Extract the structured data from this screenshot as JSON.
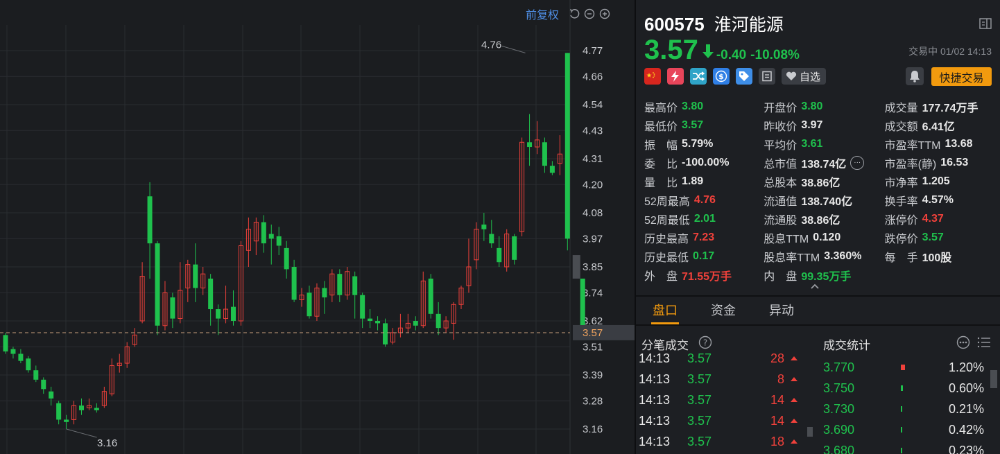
{
  "chart": {
    "fq_label": "前复权",
    "high_label": "4.76",
    "low_label": "3.16",
    "current_label": "3.57",
    "colors": {
      "up": "#f0413b",
      "down": "#1fc14d",
      "grid": "#2a2d31",
      "dash": "#c99f7d",
      "axis_text": "#c9cbcf"
    }
  },
  "chart_data": {
    "type": "candlestick",
    "ylim": [
      3.1,
      4.82
    ],
    "yticks": [
      "4.77",
      "4.66",
      "4.54",
      "4.43",
      "4.31",
      "4.20",
      "4.08",
      "3.97",
      "3.85",
      "3.74",
      "3.62",
      "3.51",
      "3.39",
      "3.28",
      "3.16"
    ],
    "last_price": 3.57,
    "candles": [
      {
        "o": 3.56,
        "c": 3.49,
        "h": 3.57,
        "l": 3.48
      },
      {
        "o": 3.5,
        "c": 3.48,
        "h": 3.51,
        "l": 3.46
      },
      {
        "o": 3.48,
        "c": 3.45,
        "h": 3.5,
        "l": 3.44
      },
      {
        "o": 3.46,
        "c": 3.41,
        "h": 3.47,
        "l": 3.4
      },
      {
        "o": 3.41,
        "c": 3.37,
        "h": 3.43,
        "l": 3.36
      },
      {
        "o": 3.37,
        "c": 3.33,
        "h": 3.38,
        "l": 3.31
      },
      {
        "o": 3.32,
        "c": 3.29,
        "h": 3.34,
        "l": 3.26
      },
      {
        "o": 3.27,
        "c": 3.2,
        "h": 3.28,
        "l": 3.18
      },
      {
        "o": 3.2,
        "c": 3.19,
        "h": 3.22,
        "l": 3.16
      },
      {
        "o": 3.2,
        "c": 3.26,
        "h": 3.28,
        "l": 3.18
      },
      {
        "o": 3.26,
        "c": 3.24,
        "h": 3.29,
        "l": 3.22
      },
      {
        "o": 3.25,
        "c": 3.26,
        "h": 3.29,
        "l": 3.24
      },
      {
        "o": 3.25,
        "c": 3.24,
        "h": 3.27,
        "l": 3.23
      },
      {
        "o": 3.26,
        "c": 3.32,
        "h": 3.34,
        "l": 3.25
      },
      {
        "o": 3.31,
        "c": 3.43,
        "h": 3.46,
        "l": 3.3
      },
      {
        "o": 3.43,
        "c": 3.44,
        "h": 3.48,
        "l": 3.4
      },
      {
        "o": 3.44,
        "c": 3.51,
        "h": 3.53,
        "l": 3.42
      },
      {
        "o": 3.52,
        "c": 3.56,
        "h": 3.59,
        "l": 3.51
      },
      {
        "o": 3.62,
        "c": 3.81,
        "h": 3.87,
        "l": 3.61
      },
      {
        "o": 4.15,
        "c": 3.95,
        "h": 4.21,
        "l": 3.8
      },
      {
        "o": 3.95,
        "c": 3.6,
        "h": 3.96,
        "l": 3.56
      },
      {
        "o": 3.6,
        "c": 3.74,
        "h": 3.79,
        "l": 3.58
      },
      {
        "o": 3.72,
        "c": 3.63,
        "h": 3.74,
        "l": 3.59
      },
      {
        "o": 3.63,
        "c": 3.75,
        "h": 3.87,
        "l": 3.61
      },
      {
        "o": 3.76,
        "c": 3.86,
        "h": 3.88,
        "l": 3.7
      },
      {
        "o": 3.86,
        "c": 3.76,
        "h": 3.95,
        "l": 3.7
      },
      {
        "o": 3.76,
        "c": 3.82,
        "h": 3.85,
        "l": 3.73
      },
      {
        "o": 3.8,
        "c": 3.67,
        "h": 3.82,
        "l": 3.6
      },
      {
        "o": 3.67,
        "c": 3.63,
        "h": 3.69,
        "l": 3.56
      },
      {
        "o": 3.63,
        "c": 3.67,
        "h": 3.77,
        "l": 3.61
      },
      {
        "o": 3.68,
        "c": 3.62,
        "h": 3.75,
        "l": 3.6
      },
      {
        "o": 3.62,
        "c": 3.94,
        "h": 3.96,
        "l": 3.6
      },
      {
        "o": 3.92,
        "c": 4.01,
        "h": 4.06,
        "l": 3.85
      },
      {
        "o": 3.96,
        "c": 4.04,
        "h": 4.06,
        "l": 3.9
      },
      {
        "o": 4.04,
        "c": 3.95,
        "h": 4.07,
        "l": 3.91
      },
      {
        "o": 3.99,
        "c": 3.97,
        "h": 4.03,
        "l": 3.86
      },
      {
        "o": 3.98,
        "c": 3.94,
        "h": 4.02,
        "l": 3.9
      },
      {
        "o": 3.93,
        "c": 3.84,
        "h": 3.96,
        "l": 3.8
      },
      {
        "o": 3.85,
        "c": 3.71,
        "h": 3.88,
        "l": 3.7
      },
      {
        "o": 3.71,
        "c": 3.73,
        "h": 3.76,
        "l": 3.68
      },
      {
        "o": 3.74,
        "c": 3.64,
        "h": 3.77,
        "l": 3.63
      },
      {
        "o": 3.64,
        "c": 3.76,
        "h": 3.78,
        "l": 3.62
      },
      {
        "o": 3.76,
        "c": 3.72,
        "h": 3.79,
        "l": 3.65
      },
      {
        "o": 3.73,
        "c": 3.82,
        "h": 3.84,
        "l": 3.7
      },
      {
        "o": 3.82,
        "c": 3.73,
        "h": 3.84,
        "l": 3.7
      },
      {
        "o": 3.73,
        "c": 3.83,
        "h": 3.85,
        "l": 3.71
      },
      {
        "o": 3.81,
        "c": 3.73,
        "h": 3.83,
        "l": 3.63
      },
      {
        "o": 3.73,
        "c": 3.63,
        "h": 3.74,
        "l": 3.59
      },
      {
        "o": 3.63,
        "c": 3.62,
        "h": 3.67,
        "l": 3.59
      },
      {
        "o": 3.62,
        "c": 3.61,
        "h": 3.64,
        "l": 3.58
      },
      {
        "o": 3.61,
        "c": 3.52,
        "h": 3.63,
        "l": 3.51
      },
      {
        "o": 3.53,
        "c": 3.57,
        "h": 3.59,
        "l": 3.52
      },
      {
        "o": 3.57,
        "c": 3.59,
        "h": 3.65,
        "l": 3.55
      },
      {
        "o": 3.59,
        "c": 3.61,
        "h": 3.65,
        "l": 3.57
      },
      {
        "o": 3.62,
        "c": 3.6,
        "h": 3.64,
        "l": 3.58
      },
      {
        "o": 3.6,
        "c": 3.79,
        "h": 3.83,
        "l": 3.59
      },
      {
        "o": 3.8,
        "c": 3.65,
        "h": 3.82,
        "l": 3.63
      },
      {
        "o": 3.65,
        "c": 3.59,
        "h": 3.7,
        "l": 3.56
      },
      {
        "o": 3.59,
        "c": 3.62,
        "h": 3.64,
        "l": 3.57
      },
      {
        "o": 3.61,
        "c": 3.69,
        "h": 3.7,
        "l": 3.54
      },
      {
        "o": 3.69,
        "c": 3.76,
        "h": 3.77,
        "l": 3.67
      },
      {
        "o": 3.77,
        "c": 3.85,
        "h": 3.97,
        "l": 3.74
      },
      {
        "o": 3.88,
        "c": 4.01,
        "h": 4.04,
        "l": 3.84
      },
      {
        "o": 4.03,
        "c": 4.01,
        "h": 4.08,
        "l": 3.96
      },
      {
        "o": 3.99,
        "c": 3.95,
        "h": 4.05,
        "l": 3.93
      },
      {
        "o": 3.93,
        "c": 3.87,
        "h": 3.98,
        "l": 3.85
      },
      {
        "o": 3.85,
        "c": 3.99,
        "h": 4.01,
        "l": 3.83
      },
      {
        "o": 3.98,
        "c": 3.88,
        "h": 3.99,
        "l": 3.86
      },
      {
        "o": 4.0,
        "c": 4.38,
        "h": 4.4,
        "l": 3.98
      },
      {
        "o": 4.38,
        "c": 4.36,
        "h": 4.5,
        "l": 4.28
      },
      {
        "o": 4.36,
        "c": 4.39,
        "h": 4.47,
        "l": 4.33
      },
      {
        "o": 4.38,
        "c": 4.28,
        "h": 4.4,
        "l": 4.25
      },
      {
        "o": 4.28,
        "c": 4.25,
        "h": 4.3,
        "l": 4.24
      },
      {
        "o": 4.29,
        "c": 4.33,
        "h": 4.41,
        "l": 4.24
      },
      {
        "o": 4.76,
        "c": 3.97,
        "h": 4.76,
        "l": 3.92
      }
    ],
    "partial_bar": {
      "top": 3.9,
      "bottom": 3.8
    },
    "last_bar": {
      "o": 3.8,
      "c": 3.57
    }
  },
  "stock": {
    "code": "600575",
    "name": "淮河能源",
    "price": "3.57",
    "change": "-0.40",
    "change_pct": "-10.08%",
    "status": "交易中 01/02 14:13",
    "watch_label": "自选",
    "fast_trade_label": "快捷交易"
  },
  "stats": [
    [
      {
        "label": "最高价",
        "value": "3.80",
        "color": "green"
      },
      {
        "label": "开盘价",
        "value": "3.80",
        "color": "green"
      },
      {
        "label": "成交量",
        "value": "177.74万手",
        "color": "white"
      }
    ],
    [
      {
        "label": "最低价",
        "value": "3.57",
        "color": "green"
      },
      {
        "label": "昨收价",
        "value": "3.97",
        "color": "white"
      },
      {
        "label": "成交额",
        "value": "6.41亿",
        "color": "white"
      }
    ],
    [
      {
        "label": "振　幅",
        "value": "5.79%",
        "color": "white"
      },
      {
        "label": "平均价",
        "value": "3.61",
        "color": "green"
      },
      {
        "label": "市盈率TTM",
        "value": "13.68",
        "color": "white"
      }
    ],
    [
      {
        "label": "委　比",
        "value": "-100.00%",
        "color": "white"
      },
      {
        "label": "总市值",
        "value": "138.74亿",
        "color": "white",
        "more": true
      },
      {
        "label": "市盈率(静)",
        "value": "16.53",
        "color": "white"
      }
    ],
    [
      {
        "label": "量　比",
        "value": "1.89",
        "color": "white"
      },
      {
        "label": "总股本",
        "value": "38.86亿",
        "color": "white"
      },
      {
        "label": "市净率",
        "value": "1.205",
        "color": "white"
      }
    ],
    [
      {
        "label": "52周最高",
        "value": "4.76",
        "color": "red"
      },
      {
        "label": "流通值",
        "value": "138.740亿",
        "color": "white"
      },
      {
        "label": "换手率",
        "value": "4.57%",
        "color": "white"
      }
    ],
    [
      {
        "label": "52周最低",
        "value": "2.01",
        "color": "green"
      },
      {
        "label": "流通股",
        "value": "38.86亿",
        "color": "white"
      },
      {
        "label": "涨停价",
        "value": "4.37",
        "color": "red"
      }
    ],
    [
      {
        "label": "历史最高",
        "value": "7.23",
        "color": "red"
      },
      {
        "label": "股息TTM",
        "value": "0.120",
        "color": "white"
      },
      {
        "label": "跌停价",
        "value": "3.57",
        "color": "green"
      }
    ],
    [
      {
        "label": "历史最低",
        "value": "0.17",
        "color": "green"
      },
      {
        "label": "股息率TTM",
        "value": "3.360%",
        "color": "white"
      },
      {
        "label": "每　手",
        "value": "100股",
        "color": "white"
      }
    ],
    [
      {
        "label": "外　盘",
        "value": "71.55万手",
        "color": "red"
      },
      {
        "label": "内　盘",
        "value": "99.35万手",
        "color": "green"
      },
      {
        "label": "",
        "value": "",
        "color": "white"
      }
    ]
  ],
  "tabs": [
    "盘口",
    "资金",
    "异动"
  ],
  "ticks": {
    "title": "分笔成交",
    "rows": [
      {
        "time": "14:13",
        "price": "3.57",
        "vol": "28"
      },
      {
        "time": "14:13",
        "price": "3.57",
        "vol": "8"
      },
      {
        "time": "14:13",
        "price": "3.57",
        "vol": "14"
      },
      {
        "time": "14:13",
        "price": "3.57",
        "vol": "14"
      },
      {
        "time": "14:13",
        "price": "3.57",
        "vol": "18"
      }
    ]
  },
  "dist": {
    "title": "成交统计",
    "rows": [
      {
        "price": "3.770",
        "pct": "1.20%",
        "bar": 1.2,
        "color": "red"
      },
      {
        "price": "3.750",
        "pct": "0.60%",
        "bar": 0.6,
        "color": "green"
      },
      {
        "price": "3.730",
        "pct": "0.21%",
        "bar": 0.21,
        "color": "green"
      },
      {
        "price": "3.690",
        "pct": "0.42%",
        "bar": 0.42,
        "color": "green"
      },
      {
        "price": "3.680",
        "pct": "0.23%",
        "bar": 0.23,
        "color": "green"
      }
    ]
  }
}
